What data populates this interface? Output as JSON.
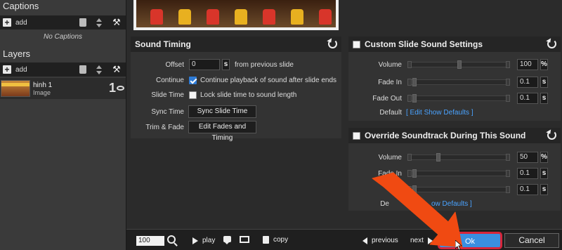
{
  "left_panel": {
    "captions_title": "Captions",
    "captions_add": "add",
    "no_captions": "No Captions",
    "layers_title": "Layers",
    "layers_add": "add",
    "layer": {
      "name": "hinh 1",
      "type": "Image",
      "number": "1"
    }
  },
  "sound_timing": {
    "title": "Sound Timing",
    "offset_label": "Offset",
    "offset_value": "0",
    "offset_unit": "s",
    "offset_suffix": "from previous slide",
    "continue_label": "Continue",
    "continue_text": "Continue playback of sound after slide ends",
    "continue_checked": true,
    "slide_time_label": "Slide Time",
    "slide_time_text": "Lock slide time to sound length",
    "slide_time_checked": false,
    "sync_time_label": "Sync Time",
    "sync_button": "Sync Slide Time",
    "trim_label": "Trim & Fade",
    "trim_button": "Edit Fades and Timing"
  },
  "custom_sound": {
    "title": "Custom Slide Sound Settings",
    "checked": false,
    "volume_label": "Volume",
    "volume_value": "100",
    "volume_unit": "%",
    "volume_level": 0.6,
    "fade_in_label": "Fade In",
    "fade_in_value": "0.1",
    "fade_in_unit": "s",
    "fade_out_label": "Fade Out",
    "fade_out_value": "0.1",
    "fade_out_unit": "s",
    "default_label": "Default",
    "default_link": "[ Edit Show Defaults ]"
  },
  "override_soundtrack": {
    "title": "Override Soundtrack During This Sound",
    "checked": false,
    "volume_label": "Volume",
    "volume_value": "50",
    "volume_unit": "%",
    "volume_level": 0.3,
    "fade_in_label": "Fade In",
    "fade_in_value": "0.1",
    "fade_in_unit": "s",
    "third_value": "0.1",
    "third_unit": "s",
    "default_label": "De",
    "default_link": "ow Defaults ]"
  },
  "bottom_bar": {
    "zoom_value": "100",
    "play_label": "play",
    "copy_label": "copy",
    "previous_label": "previous",
    "next_label": "next",
    "ok_label": "Ok",
    "cancel_label": "Cancel"
  },
  "colors": {
    "accent_blue": "#3a8fe0",
    "highlight_red": "#d8253a",
    "annotation_arrow": "#f04a12"
  }
}
